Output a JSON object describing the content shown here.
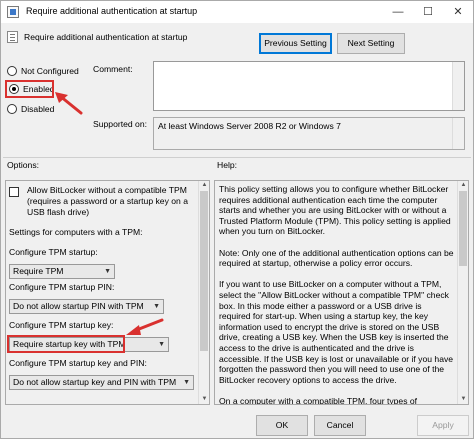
{
  "window": {
    "title": "Require additional authentication at startup",
    "close_glyph": "✕",
    "min_glyph": "—",
    "max_glyph": "☐"
  },
  "header": {
    "setting_name": "Require additional authentication at startup",
    "prev_label": "Previous Setting",
    "next_label": "Next Setting"
  },
  "state": {
    "options": [
      "Not Configured",
      "Enabled",
      "Disabled"
    ],
    "selected": "Enabled"
  },
  "comment": {
    "label": "Comment:",
    "value": ""
  },
  "supported": {
    "label": "Supported on:",
    "value": "At least Windows Server 2008 R2 or Windows 7"
  },
  "sections": {
    "options_label": "Options:",
    "help_label": "Help:"
  },
  "options": {
    "checkbox_label": "Allow BitLocker without a compatible TPM (requires a password or a startup key on a USB flash drive)",
    "checkbox_checked": false,
    "settings_heading": "Settings for computers with a TPM:",
    "fields": [
      {
        "label": "Configure TPM startup:",
        "value": "Require TPM"
      },
      {
        "label": "Configure TPM startup PIN:",
        "value": "Do not allow startup PIN with TPM"
      },
      {
        "label": "Configure TPM startup key:",
        "value": "Require startup key with TPM"
      },
      {
        "label": "Configure TPM startup key and PIN:",
        "value": "Do not allow startup key and PIN with TPM"
      }
    ]
  },
  "help": {
    "paragraphs": [
      "This policy setting allows you to configure whether BitLocker requires additional authentication each time the computer starts and whether you are using BitLocker with or without a Trusted Platform Module (TPM). This policy setting is applied when you turn on BitLocker.",
      "Note: Only one of the additional authentication options can be required at startup, otherwise a policy error occurs.",
      "If you want to use BitLocker on a computer without a TPM, select the \"Allow BitLocker without a compatible TPM\" check box. In this mode either a password or a USB drive is required for start-up. When using a startup key, the key information used to encrypt the drive is stored on the USB drive, creating a USB key. When the USB key is inserted the access to the drive is authenticated and the drive is accessible. If the USB key is lost or unavailable or if you have forgotten the password then you will need to use one of the BitLocker recovery options to access the drive.",
      "On a computer with a compatible TPM, four types of"
    ]
  },
  "footer": {
    "ok_label": "OK",
    "cancel_label": "Cancel",
    "apply_label": "Apply"
  },
  "colors": {
    "highlight_red": "#d9312f",
    "accent_blue": "#0078d7"
  }
}
